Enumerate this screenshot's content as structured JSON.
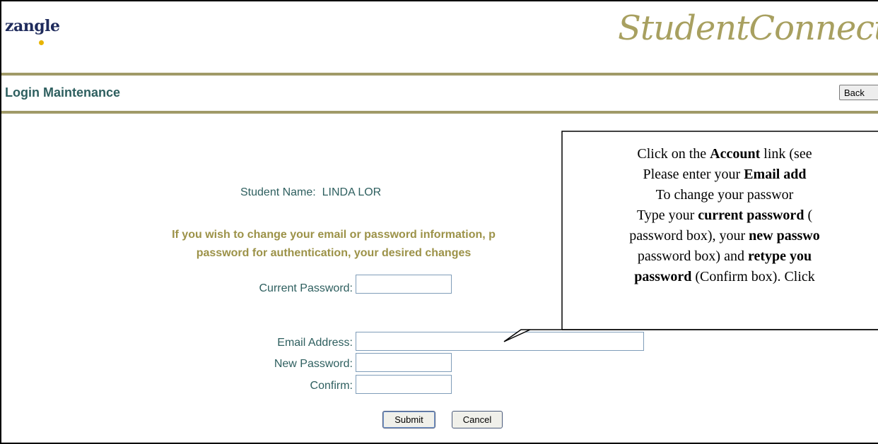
{
  "header": {
    "logo_text": "zangle",
    "brand_title": "StudentConnection"
  },
  "toolbar": {
    "section_title": "Login Maintenance",
    "back_label": "Back"
  },
  "student": {
    "label": "Student Name:",
    "name": "LINDA LOR"
  },
  "notice": {
    "line1": "If you wish to change your email or password information, p",
    "line2": "password for authentication, your desired changes"
  },
  "form": {
    "current_password_label": "Current Password:",
    "email_label": "Email Address:",
    "new_password_label": "New Password:",
    "confirm_label": "Confirm:",
    "current_password_value": "",
    "email_value": "",
    "new_password_value": "",
    "confirm_value": "",
    "submit_label": "Submit",
    "cancel_label": "Cancel"
  },
  "callout": {
    "l1a": "Click on the ",
    "l1b": "Account",
    "l1c": " link (see",
    "l2a": "Please enter your ",
    "l2b": "Email add",
    "l3a": "To change your passwor",
    "l4a": "Type your ",
    "l4b": "current password",
    "l4c": " (",
    "l5a": "password box), your ",
    "l5b": "new passwo",
    "l6a": "password box) and ",
    "l6b": "retype you",
    "l7a": "password",
    "l7b": " (Confirm box).  Click"
  },
  "colors": {
    "rule": "#a09a68",
    "heading": "#2e5f5f",
    "notice": "#9c9248",
    "brand": "#a8a060"
  }
}
